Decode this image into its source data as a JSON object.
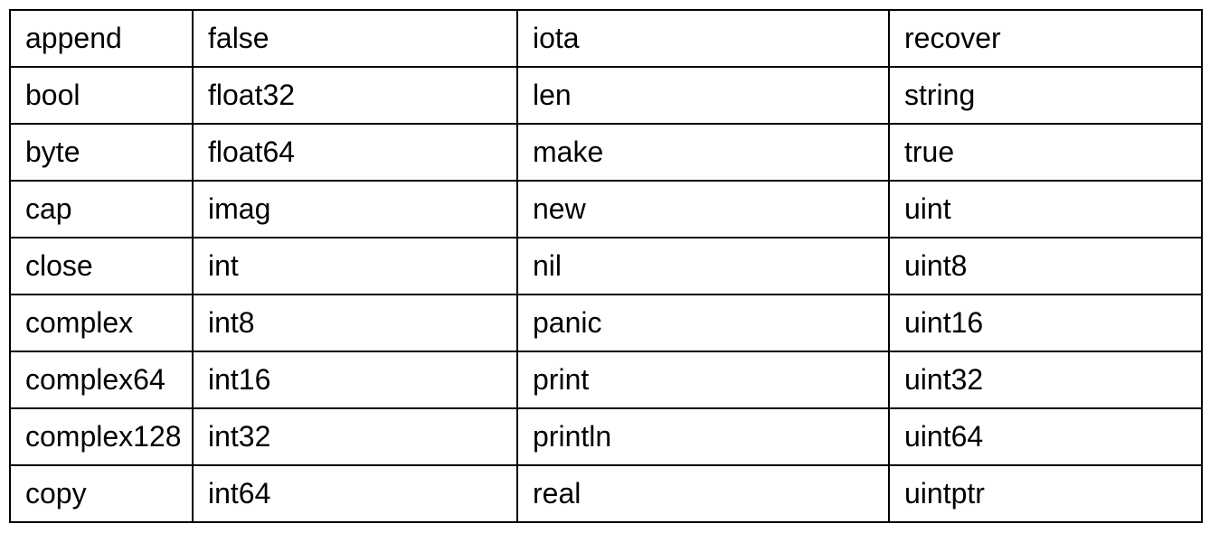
{
  "chart_data": {
    "type": "table",
    "rows": 9,
    "columns": 4,
    "cells": [
      [
        "append",
        "false",
        "iota",
        "recover"
      ],
      [
        "bool",
        "float32",
        "len",
        "string"
      ],
      [
        "byte",
        "float64",
        "make",
        "true"
      ],
      [
        "cap",
        "imag",
        "new",
        "uint"
      ],
      [
        "close",
        "int",
        "nil",
        "uint8"
      ],
      [
        "complex",
        "int8",
        "panic",
        "uint16"
      ],
      [
        "complex64",
        "int16",
        "print",
        "uint32"
      ],
      [
        "complex128",
        "int32",
        "println",
        "uint64"
      ],
      [
        "copy",
        "int64",
        "real",
        "uintptr"
      ]
    ]
  }
}
